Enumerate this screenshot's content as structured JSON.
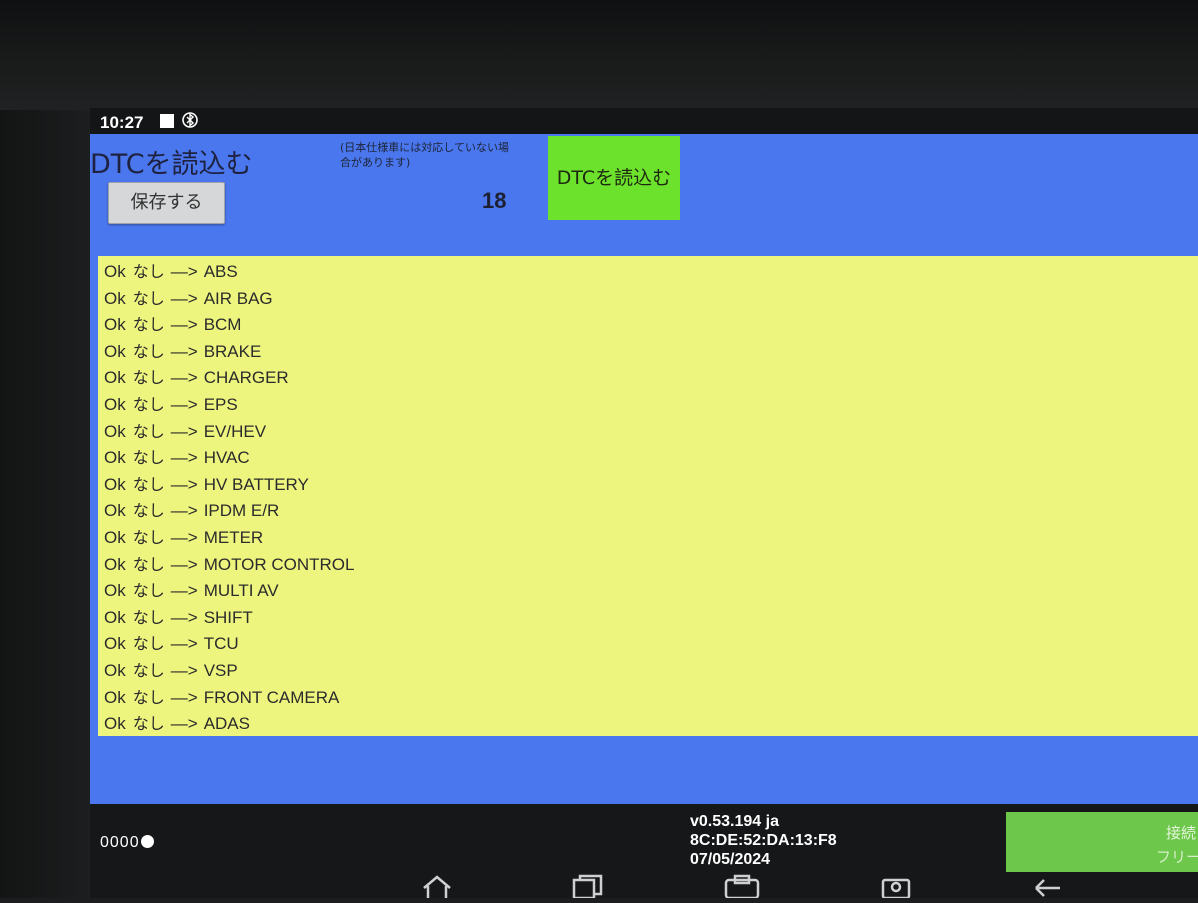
{
  "status_bar": {
    "time": "10:27"
  },
  "header": {
    "title": "DTCを読込む",
    "note": "(日本仕様車には対応していない場合があります)",
    "save_label": "保存する",
    "count": "18",
    "read_button_label": "DTCを読込む"
  },
  "results": [
    {
      "status": "Ok",
      "dtc": "なし",
      "arrow": "—>",
      "module": "ABS"
    },
    {
      "status": "Ok",
      "dtc": "なし",
      "arrow": "—>",
      "module": "AIR BAG"
    },
    {
      "status": "Ok",
      "dtc": "なし",
      "arrow": "—>",
      "module": "BCM"
    },
    {
      "status": "Ok",
      "dtc": "なし",
      "arrow": "—>",
      "module": "BRAKE"
    },
    {
      "status": "Ok",
      "dtc": "なし",
      "arrow": "—>",
      "module": "CHARGER"
    },
    {
      "status": "Ok",
      "dtc": "なし",
      "arrow": "—>",
      "module": "EPS"
    },
    {
      "status": "Ok",
      "dtc": "なし",
      "arrow": "—>",
      "module": "EV/HEV"
    },
    {
      "status": "Ok",
      "dtc": "なし",
      "arrow": "—>",
      "module": "HVAC"
    },
    {
      "status": "Ok",
      "dtc": "なし",
      "arrow": "—>",
      "module": "HV BATTERY"
    },
    {
      "status": "Ok",
      "dtc": "なし",
      "arrow": "—>",
      "module": "IPDM E/R"
    },
    {
      "status": "Ok",
      "dtc": "なし",
      "arrow": "—>",
      "module": "METER"
    },
    {
      "status": "Ok",
      "dtc": "なし",
      "arrow": "—>",
      "module": "MOTOR CONTROL"
    },
    {
      "status": "Ok",
      "dtc": "なし",
      "arrow": "—>",
      "module": "MULTI AV"
    },
    {
      "status": "Ok",
      "dtc": "なし",
      "arrow": "—>",
      "module": "SHIFT"
    },
    {
      "status": "Ok",
      "dtc": "なし",
      "arrow": "—>",
      "module": "TCU"
    },
    {
      "status": "Ok",
      "dtc": "なし",
      "arrow": "—>",
      "module": "VSP"
    },
    {
      "status": "Ok",
      "dtc": "なし",
      "arrow": "—>",
      "module": "FRONT CAMERA"
    },
    {
      "status": "Ok",
      "dtc": "なし",
      "arrow": "—>",
      "module": "ADAS"
    }
  ],
  "footer": {
    "dots": "0000",
    "version": "v0.53.194 ja",
    "mac": "8C:DE:52:DA:13:F8",
    "date": "07/05/2024",
    "connect_label": "接続",
    "connect_sub": "フリー"
  },
  "icons": {
    "status_square": "square-icon",
    "bluetooth": "bluetooth-icon",
    "home": "home-icon",
    "recents": "recents-icon",
    "screenshot": "screenshot-icon",
    "back": "back-icon"
  },
  "colors": {
    "panel_blue": "#4a77ee",
    "list_yellow": "#eef57f",
    "read_button_green": "#6de22d",
    "connect_green": "#6cc74a"
  }
}
